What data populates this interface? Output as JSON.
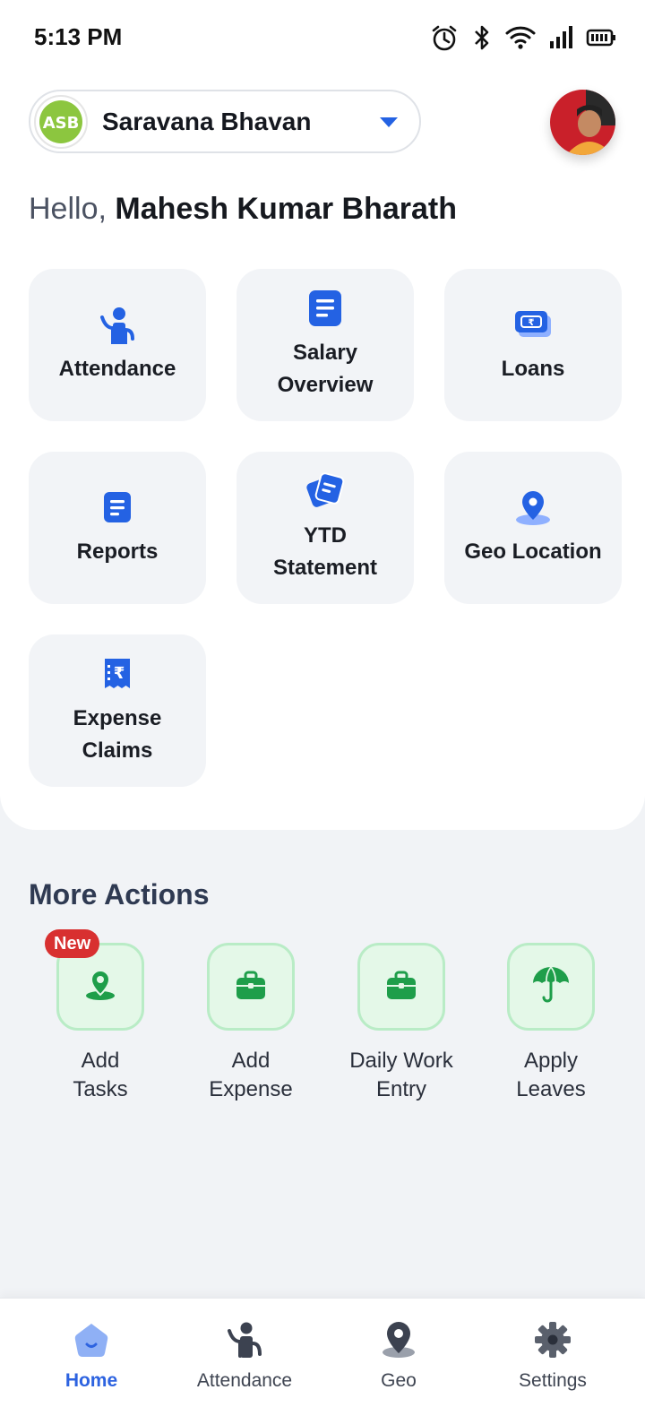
{
  "status_bar": {
    "time": "5:13 PM"
  },
  "header": {
    "company_name": "Saravana Bhavan",
    "company_logo_text": "ASB"
  },
  "greeting": {
    "prefix": "Hello, ",
    "user_name": "Mahesh Kumar Bharath"
  },
  "tiles": [
    {
      "label": "Attendance",
      "icon": "attendance-icon"
    },
    {
      "label": "Salary\nOverview",
      "icon": "document-icon"
    },
    {
      "label": "Loans",
      "icon": "rupee-cash-icon"
    },
    {
      "label": "Reports",
      "icon": "report-icon"
    },
    {
      "label": "YTD\nStatement",
      "icon": "statement-icon"
    },
    {
      "label": "Geo Location",
      "icon": "location-pin-icon"
    },
    {
      "label": "Expense\nClaims",
      "icon": "rupee-receipt-icon"
    }
  ],
  "more_actions": {
    "title": "More Actions",
    "badge": "New",
    "items": [
      {
        "label": "Add\nTasks",
        "icon": "task-location-icon"
      },
      {
        "label": "Add\nExpense",
        "icon": "briefcase-icon"
      },
      {
        "label": "Daily Work\nEntry",
        "icon": "briefcase-icon"
      },
      {
        "label": "Apply\nLeaves",
        "icon": "umbrella-icon"
      }
    ]
  },
  "bottom_nav": [
    {
      "label": "Home",
      "icon": "home-icon",
      "active": true
    },
    {
      "label": "Attendance",
      "icon": "attendance-icon",
      "active": false
    },
    {
      "label": "Geo",
      "icon": "location-pin-icon",
      "active": false
    },
    {
      "label": "Settings",
      "icon": "gear-icon",
      "active": false
    }
  ],
  "colors": {
    "accent_blue": "#2462e3",
    "action_green": "#1e9e4a",
    "badge_red": "#d83030"
  }
}
